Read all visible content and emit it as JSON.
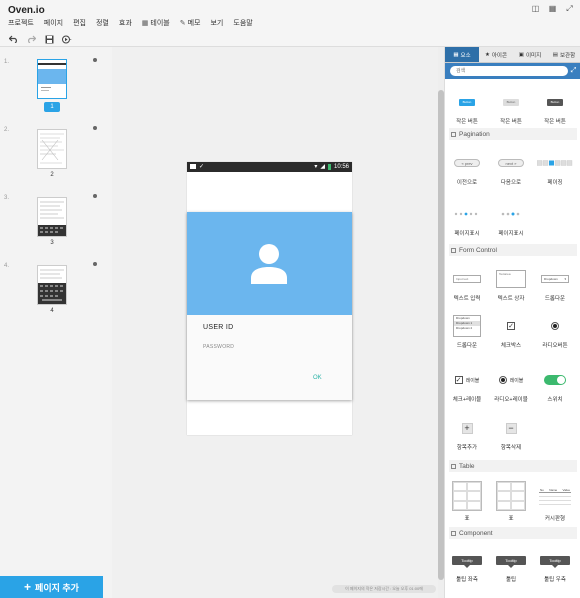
{
  "app": {
    "title": "Oven.io"
  },
  "menu": [
    "프로젝트",
    "페이지",
    "편집",
    "정렬",
    "효과",
    "테이블",
    "메모",
    "보기",
    "도움말"
  ],
  "pages": [
    {
      "number": "1.",
      "label": "1",
      "active": true
    },
    {
      "number": "2.",
      "label": "2",
      "active": false
    },
    {
      "number": "3.",
      "label": "3",
      "active": false
    },
    {
      "number": "4.",
      "label": "4",
      "active": false
    }
  ],
  "add_page_label": "페이지 추가",
  "phone": {
    "time": "10:56",
    "userid": "USER ID",
    "password": "PASSWORD",
    "ok": "OK"
  },
  "save_status": "이 페이지의 작은 저장시간 : 오늘 오후 01:00에",
  "panel": {
    "tabs": [
      "요소",
      "아이콘",
      "이미지",
      "보관함"
    ],
    "search_placeholder": "검색",
    "sections": {
      "pagination": "Pagination",
      "form": "Form Control",
      "table": "Table",
      "component": "Component"
    },
    "buttons": [
      {
        "preview": "Button",
        "label": "작은 버튼"
      },
      {
        "preview": "Button",
        "label": "작은 버튼"
      },
      {
        "preview": "Button",
        "label": "작은 버튼"
      }
    ],
    "pagination": [
      {
        "preview": "« prev",
        "label": "이전으로"
      },
      {
        "preview": "next »",
        "label": "다음으로"
      },
      {
        "preview": "",
        "label": "페이징"
      },
      {
        "preview": "",
        "label": "페이지표시"
      },
      {
        "preview": "",
        "label": "페이지표시"
      }
    ],
    "form": [
      {
        "preview": "Input text",
        "label": "텍스트 입력"
      },
      {
        "preview": "Textarea",
        "label": "텍스트 상자"
      },
      {
        "preview": "Dropdown",
        "label": "드롭다운"
      },
      {
        "preview": "Dropdown",
        "label": "드롭다운",
        "options": [
          "Dropdown 1",
          "Dropdown 2"
        ]
      },
      {
        "preview": "",
        "label": "체크박스"
      },
      {
        "preview": "",
        "label": "라디오버튼"
      },
      {
        "preview": "레이블",
        "label": "체크+레이블"
      },
      {
        "preview": "레이블",
        "label": "라디오+레이블"
      },
      {
        "preview": "",
        "label": "스위치"
      },
      {
        "preview": "+",
        "label": "항목추가"
      },
      {
        "preview": "−",
        "label": "항목삭제"
      }
    ],
    "tables": [
      {
        "label": "표"
      },
      {
        "label": "표"
      },
      {
        "label": "커시판형",
        "headers": [
          "No",
          "Name",
          "Value"
        ]
      }
    ],
    "tooltips": [
      {
        "preview": "Tooltip",
        "label": "툴팁 좌측"
      },
      {
        "preview": "Tooltip",
        "label": "툴팁"
      },
      {
        "preview": "Tooltip",
        "label": "툴팁 우측"
      }
    ]
  },
  "colors": {
    "accent": "#2aa3e6",
    "hero": "#6bb6ee",
    "ok": "#2bb3a6",
    "switch": "#3cb96e"
  }
}
